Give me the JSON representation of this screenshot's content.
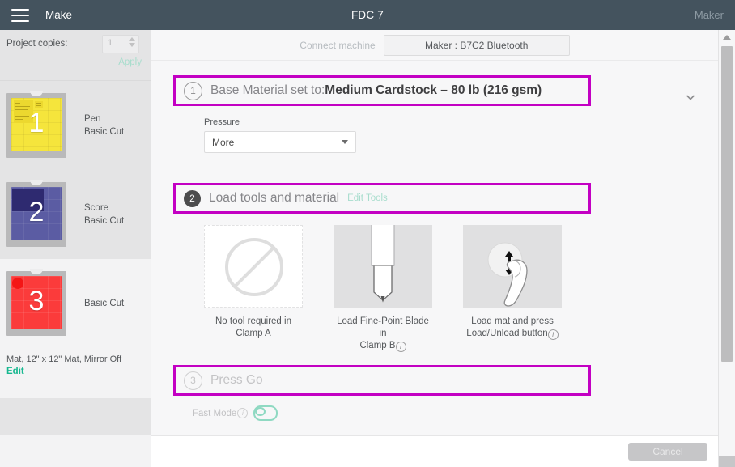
{
  "topbar": {
    "menu_icon": "hamburger-icon",
    "app_label": "Make",
    "title": "FDC 7",
    "machine_label": "Maker"
  },
  "sidebar": {
    "copies_label": "Project copies:",
    "copies_value": "1",
    "apply_label": "Apply",
    "mats": [
      {
        "number": "1",
        "color": "#f5e53c",
        "line1": "Pen",
        "line2": "Basic Cut"
      },
      {
        "number": "2",
        "color": "#474894",
        "line1": "Score",
        "line2": "Basic Cut"
      },
      {
        "number": "3",
        "color": "#fb3b3b",
        "line1": "Basic Cut",
        "line2": ""
      }
    ],
    "footer_text": "Mat, 12\" x 12\" Mat, Mirror Off",
    "edit_label": "Edit"
  },
  "connect": {
    "label": "Connect machine",
    "button_label": "Maker : B7C2 Bluetooth"
  },
  "steps": {
    "one": {
      "number": "1",
      "prefix": "Base Material set to:",
      "value": "Medium Cardstock – 80 lb (216 gsm)",
      "chevron_icon": "chevron-down-icon"
    },
    "two": {
      "number": "2",
      "title": "Load tools and material",
      "edit_tools_label": "Edit Tools"
    },
    "three": {
      "number": "3",
      "title": "Press Go"
    }
  },
  "pressure": {
    "label": "Pressure",
    "value": "More",
    "caret_icon": "caret-down-icon"
  },
  "tools": [
    {
      "icon": "no-tool-icon",
      "caption_line1": "No tool required in",
      "caption_line2": "Clamp A",
      "has_info": false
    },
    {
      "icon": "fine-point-blade-icon",
      "caption_line1": "Load Fine-Point Blade in",
      "caption_line2": "Clamp B",
      "has_info": true
    },
    {
      "icon": "load-mat-finger-icon",
      "caption_line1": "Load mat and press",
      "caption_line2": "Load/Unload button",
      "has_info": true
    }
  ],
  "fast_mode": {
    "label": "Fast Mode",
    "info_icon": "info-icon",
    "enabled": false
  },
  "bottom": {
    "cancel_label": "Cancel"
  },
  "colors": {
    "highlight": "#c300c3",
    "topbar": "#44535e",
    "accent_teal": "#17b890"
  }
}
